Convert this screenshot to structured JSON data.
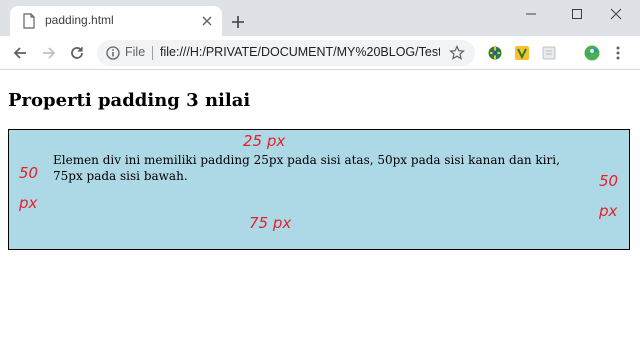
{
  "browser": {
    "tab": {
      "title": "padding.html",
      "favicon": "document-icon"
    },
    "omnibox": {
      "scheme_label": "File",
      "url": "file:///H:/PRIVATE/DOCUMENT/MY%20BLOG/Test..."
    },
    "extensions": [
      "extension-green-icon",
      "extension-v-icon",
      "extension-page-icon"
    ]
  },
  "page": {
    "heading": "Properti padding 3 nilai",
    "box": {
      "text": "Elemen div ini memiliki padding 25px pada sisi atas, 50px pada sisi kanan dan kiri, 75px pada sisi bawah.",
      "background": "#add8e6"
    },
    "annotations": {
      "top": "25 px",
      "bottom": "75 px",
      "left_value": "50",
      "left_unit": "px",
      "right_value": "50",
      "right_unit": "px",
      "color": "#e8202a"
    }
  }
}
